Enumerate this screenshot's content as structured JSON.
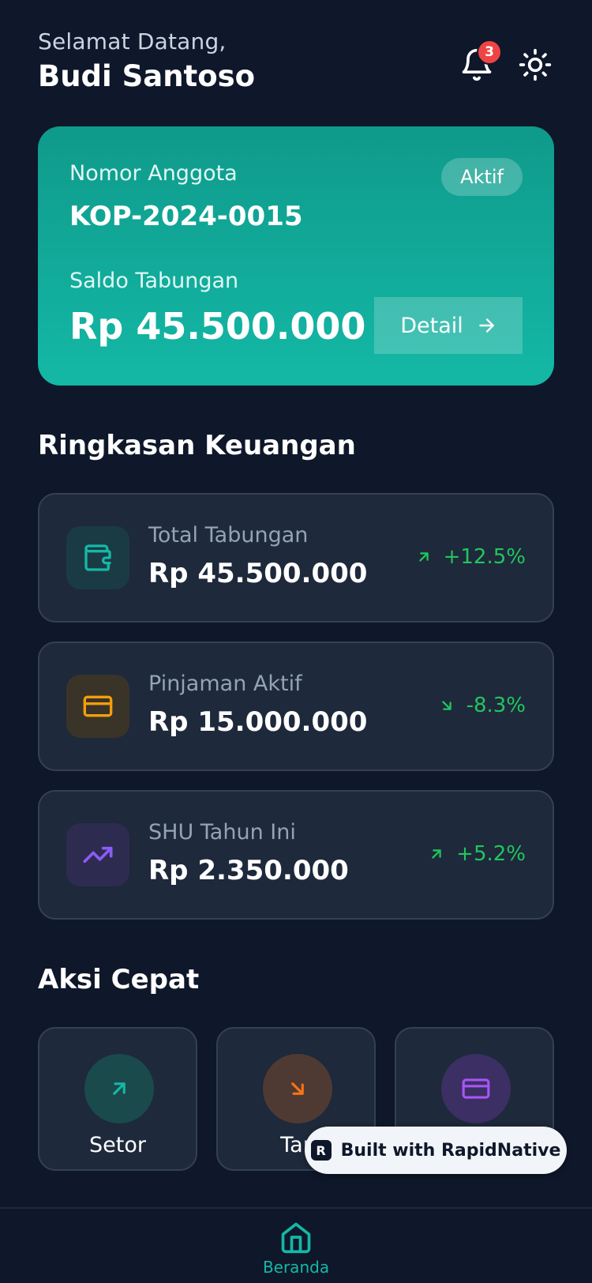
{
  "header": {
    "greeting": "Selamat Datang,",
    "username": "Budi Santoso",
    "notification_count": "3"
  },
  "member_card": {
    "member_label": "Nomor Anggota",
    "member_number": "KOP-2024-0015",
    "status": "Aktif",
    "balance_label": "Saldo Tabungan",
    "balance": "Rp 45.500.000",
    "detail_label": "Detail"
  },
  "summary": {
    "title": "Ringkasan Keuangan",
    "items": [
      {
        "label": "Total Tabungan",
        "value": "Rp 45.500.000",
        "trend": "+12.5%",
        "direction": "up",
        "icon": "wallet-icon"
      },
      {
        "label": "Pinjaman Aktif",
        "value": "Rp 15.000.000",
        "trend": "-8.3%",
        "direction": "down",
        "icon": "credit-card-icon"
      },
      {
        "label": "SHU Tahun Ini",
        "value": "Rp 2.350.000",
        "trend": "+5.2%",
        "direction": "up",
        "icon": "trending-up-icon"
      }
    ]
  },
  "quick_actions": {
    "title": "Aksi Cepat",
    "items": [
      {
        "label": "Setor",
        "icon": "arrow-up-right-icon"
      },
      {
        "label": "Tar",
        "icon": "arrow-down-right-icon"
      },
      {
        "label": "",
        "icon": "credit-card-icon"
      }
    ]
  },
  "builder_badge": {
    "label": "Built with RapidNative"
  },
  "bottom_nav": {
    "items": [
      {
        "label": "Beranda",
        "icon": "home-icon"
      }
    ]
  },
  "colors": {
    "background": "#0f172a",
    "card": "#1e293b",
    "accent": "#14b8a6",
    "positive": "#22c55e",
    "warning": "#f59e0b",
    "purple": "#8b5cf6",
    "danger": "#ef4444"
  }
}
